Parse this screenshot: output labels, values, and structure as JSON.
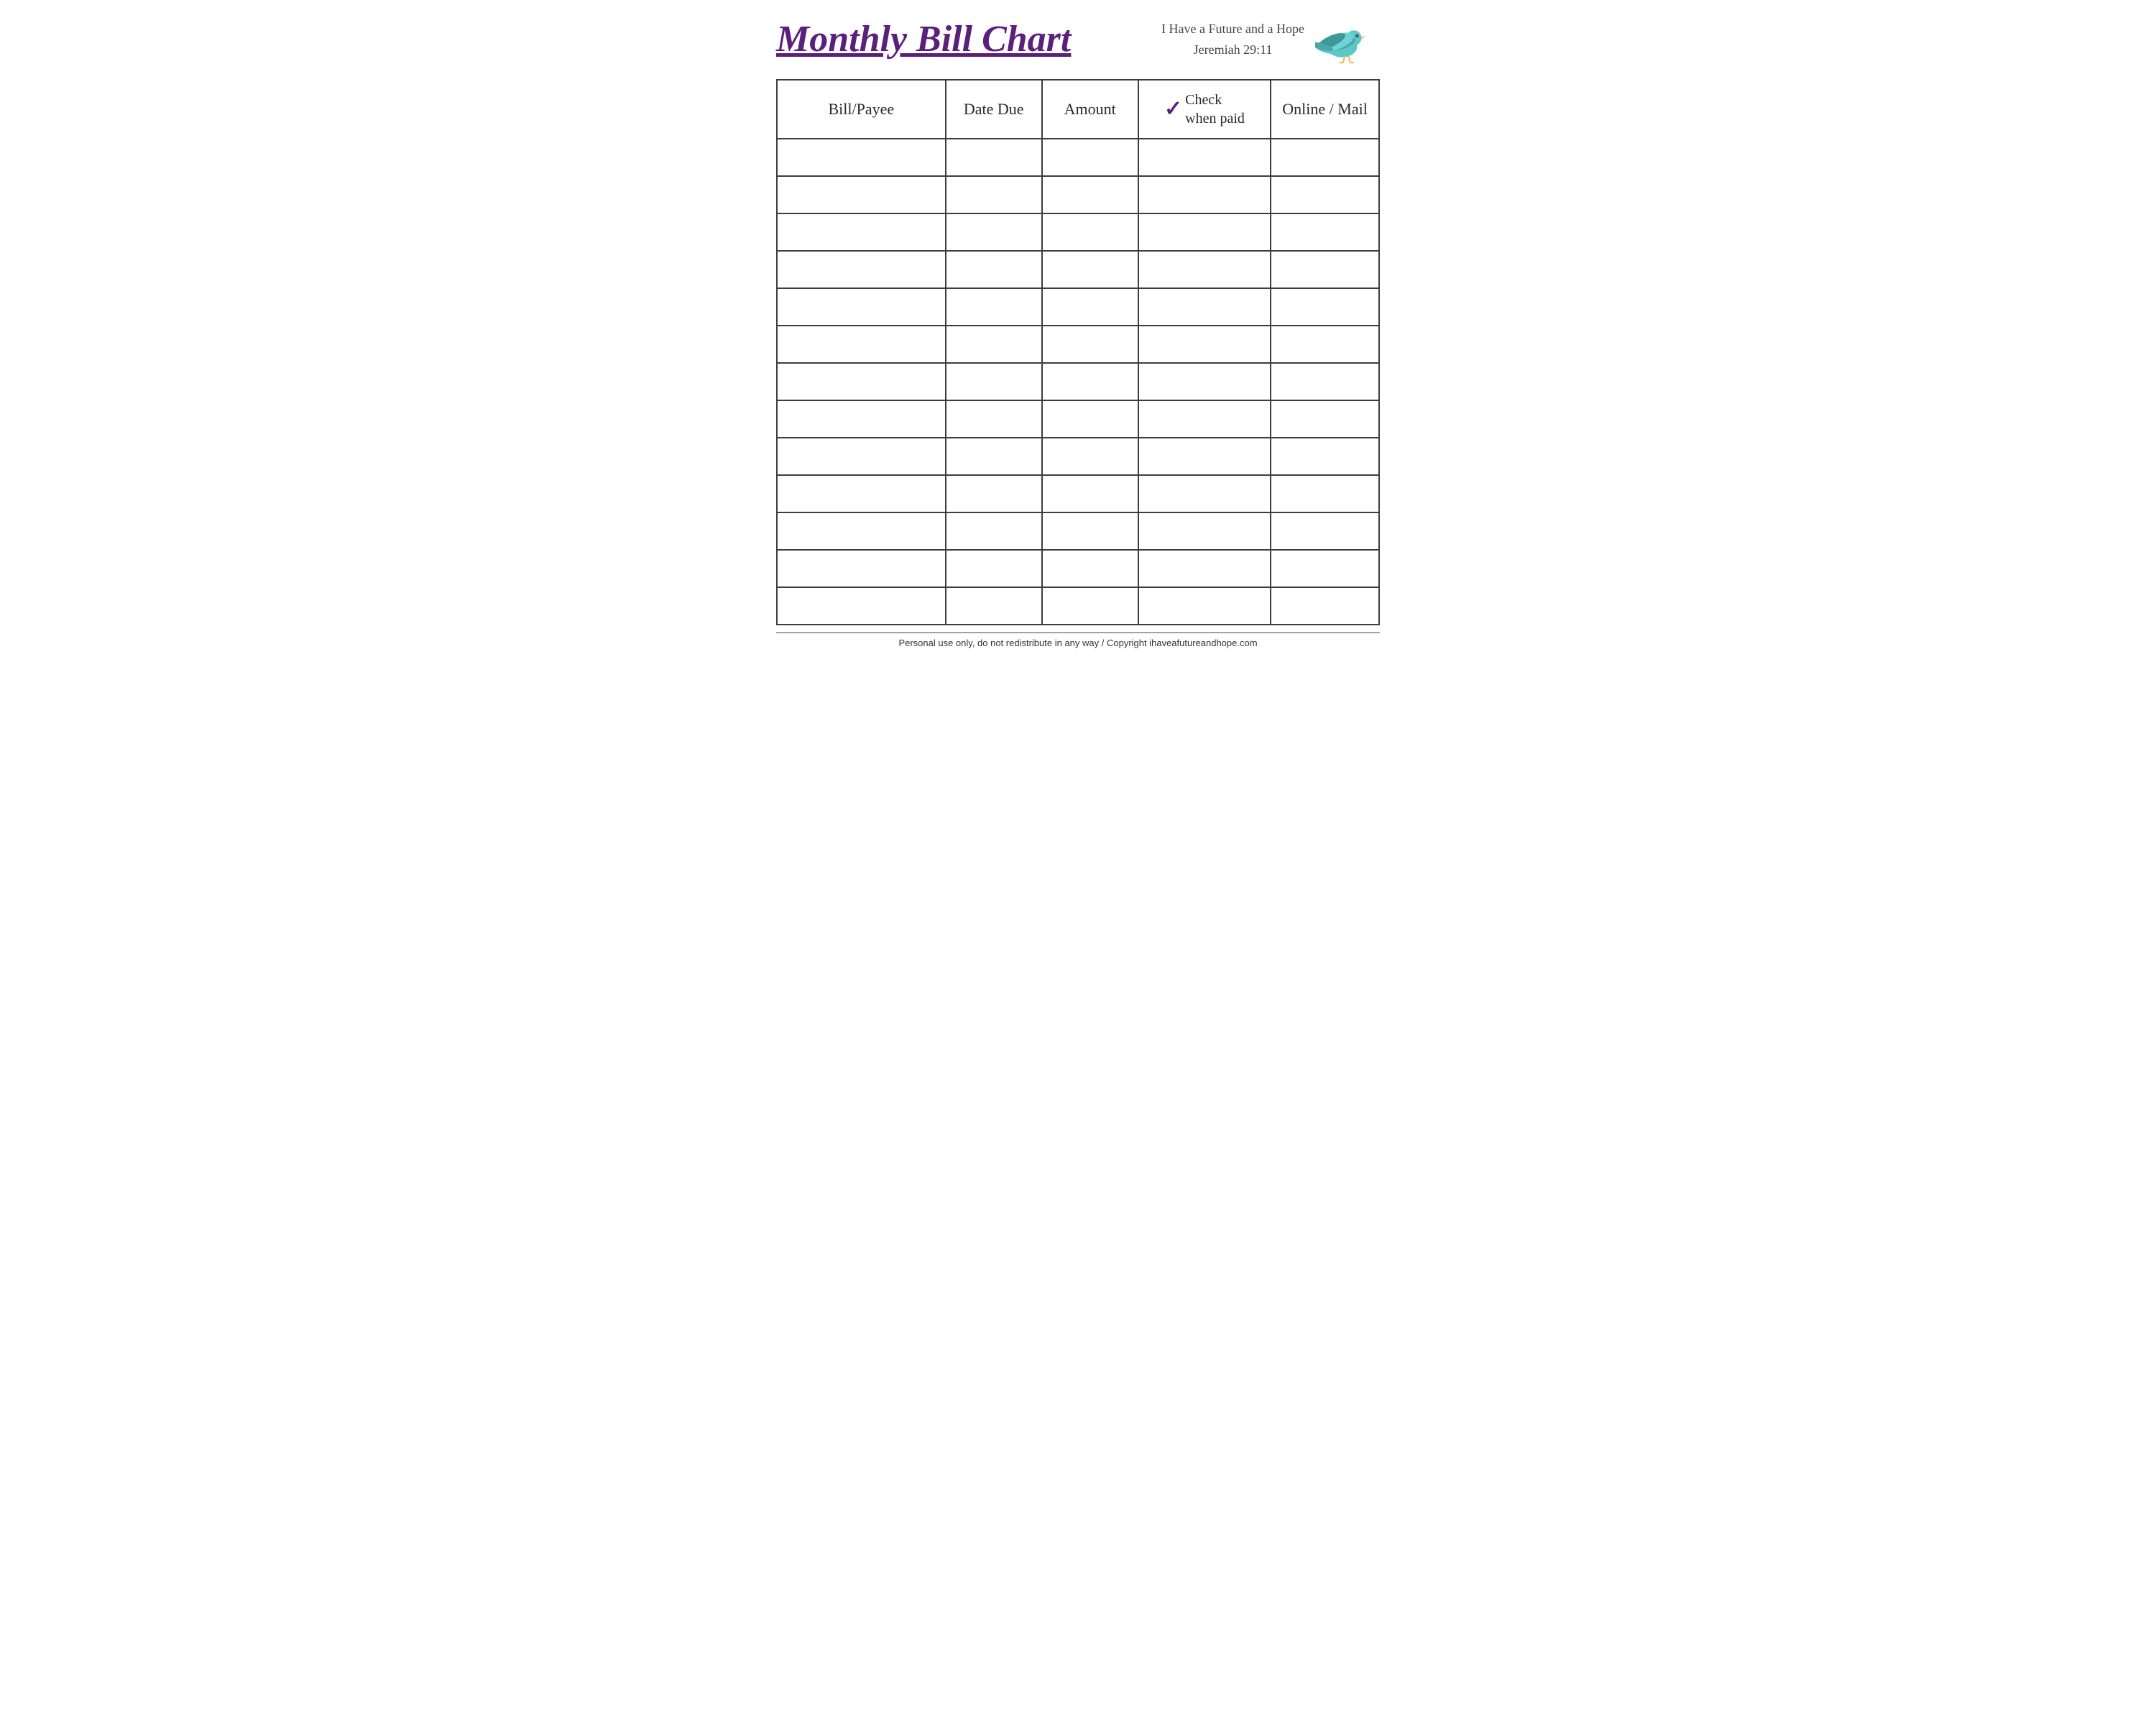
{
  "header": {
    "title": "Monthly Bill Chart",
    "subtitle_line1": "I Have a Future and a Hope",
    "subtitle_line2": "Jeremiah 29:11"
  },
  "table": {
    "columns": [
      {
        "id": "bill-payee",
        "label": "Bill/Payee"
      },
      {
        "id": "date-due",
        "label": "Date Due"
      },
      {
        "id": "amount",
        "label": "Amount"
      },
      {
        "id": "check-when-paid",
        "label_line1": "Check",
        "label_line2": "when paid"
      },
      {
        "id": "online-mail",
        "label": "Online / Mail"
      }
    ],
    "row_count": 13
  },
  "footer": {
    "text": "Personal use only, do not redistribute in any way / Copyright ihaveafutureandhope.com"
  }
}
